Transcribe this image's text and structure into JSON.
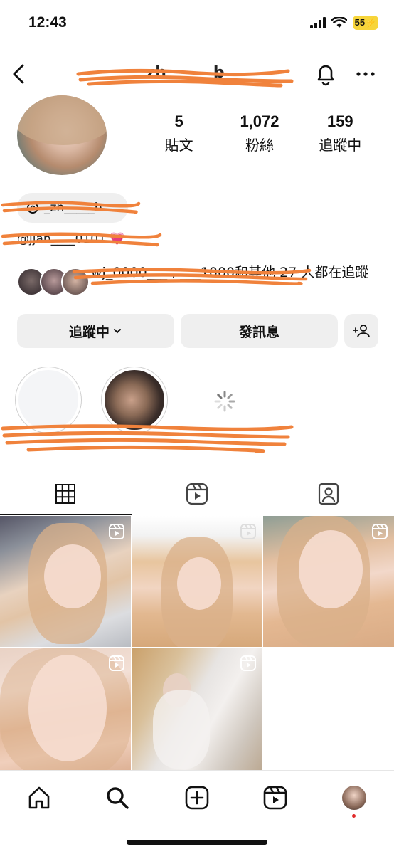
{
  "status_bar": {
    "time": "12:43",
    "battery": "55"
  },
  "header": {
    "username": "_zh______b",
    "icons": [
      "back-icon",
      "bell-icon",
      "more-icon"
    ]
  },
  "stats": [
    {
      "value": "5",
      "label": "貼文"
    },
    {
      "value": "1,072",
      "label": "粉絲"
    },
    {
      "value": "159",
      "label": "追蹤中"
    }
  ],
  "threads_badge": {
    "text": "_zh_____b"
  },
  "bio": {
    "link": "@jjah____0101"
  },
  "mutual": {
    "text": "wj_0000___ , ___1000和其他 27 人都在追蹤"
  },
  "buttons": {
    "follow": "追蹤中",
    "message": "發訊息"
  },
  "tabs": [
    "grid-icon",
    "reels-icon",
    "tagged-icon"
  ],
  "posts_count": 5,
  "bottom_nav": [
    "home-icon",
    "search-icon",
    "create-icon",
    "reels-icon",
    "profile-avatar"
  ],
  "colors": {
    "scribble": "#f0823c",
    "battery": "#f7d53b",
    "notification_dot": "#e02a2a"
  }
}
